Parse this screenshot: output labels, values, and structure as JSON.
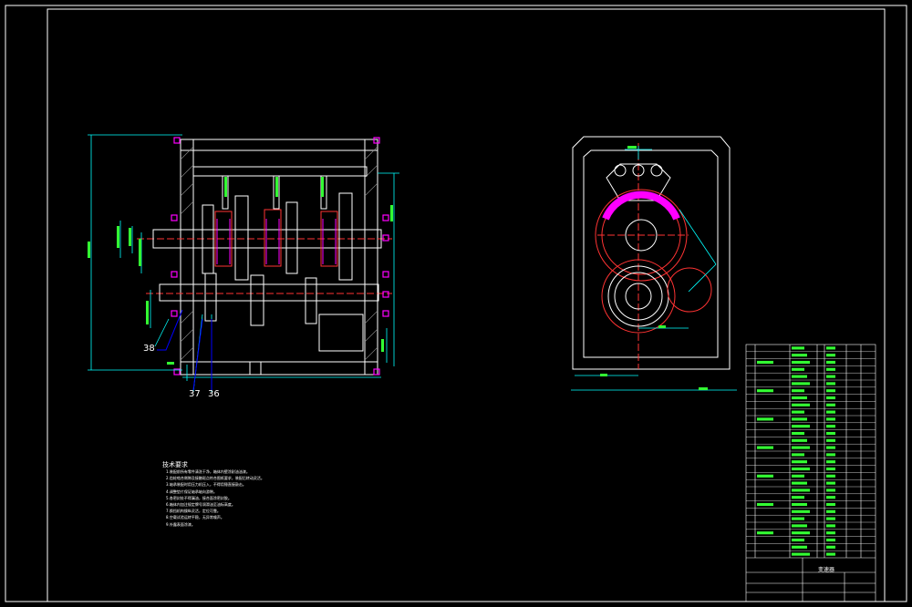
{
  "drawing": {
    "callouts": [
      "38",
      "37",
      "36"
    ],
    "technical_requirements": {
      "title": "技术要求",
      "lines": [
        "1.装配前所有零件清洗干净，箱体内壁涂耐油油漆。",
        "2.齿轮啮合侧隙及接触斑点符合图纸要求，装配后转动灵活。",
        "3.轴承装配时用压力机压入，不得用锤直接敲击。",
        "4.调整垫片保证轴承轴向游隙。",
        "5.各密封处不得漏油，接合面涂密封胶。",
        "6.箱体内加注规定牌号润滑油至油标高度。",
        "7.换挡机构操纵灵活，定位可靠。",
        "8.空载试验运转平稳，无异常噪声。",
        "9.外露表面涂漆。"
      ]
    },
    "title_block": {
      "title": "变速器"
    },
    "colors": {
      "frame": "#ffffff",
      "dimension": "#00ffff",
      "gear": "#ff3333",
      "shaft": "#ff00ff",
      "label_text": "#33ff33"
    }
  }
}
